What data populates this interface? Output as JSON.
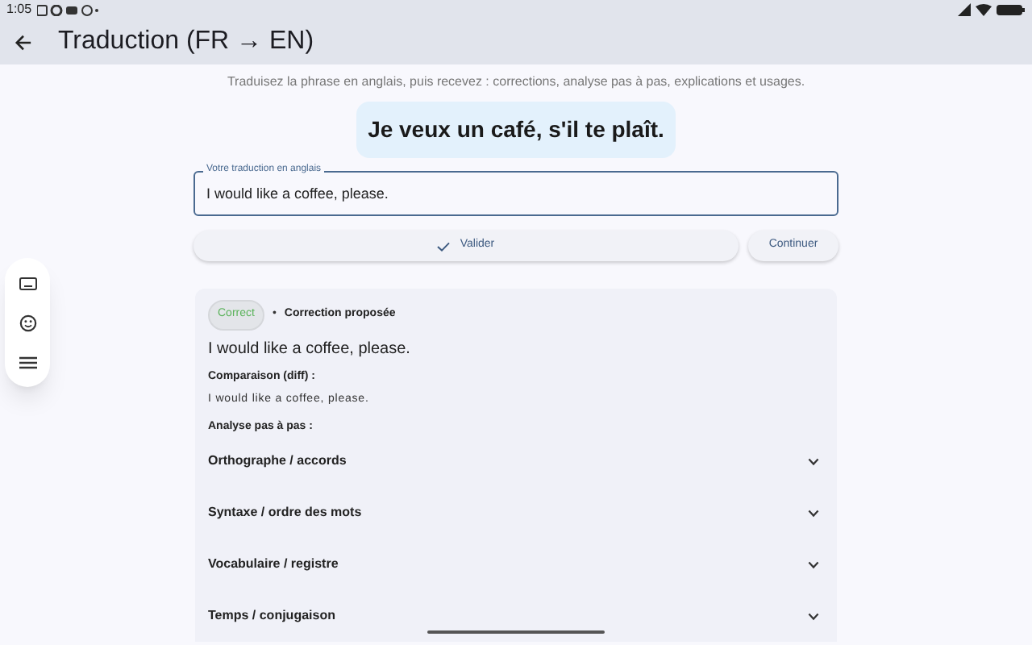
{
  "status_bar": {
    "time": "1:05"
  },
  "app_bar": {
    "title": "Traduction (FR → EN)"
  },
  "instructions": "Traduisez la phrase en anglais, puis recevez : corrections, analyse pas à pas, explications et usages.",
  "source_sentence": "Je veux un café, s'il te plaît.",
  "translation_field": {
    "label": "Votre traduction en anglais",
    "value": "I would like a coffee, please.",
    "focused": true
  },
  "buttons": [
    {
      "label": "Valider",
      "kind": "primary"
    },
    {
      "label": "Continuer",
      "kind": "secondary"
    }
  ],
  "result": {
    "badge": "Correct",
    "separator": "•",
    "heading": "Correction proposée",
    "corrected": "I would like a coffee, please.",
    "diff_label": "Comparaison (diff) :",
    "diff_text": "I would like a coffee, please.",
    "analysis_label": "Analyse pas à pas :",
    "sections": [
      {
        "title": "Orthographe / accords",
        "expanded": false
      },
      {
        "title": "Syntaxe / ordre des mots",
        "expanded": false
      },
      {
        "title": "Vocabulaire / registre",
        "expanded": false
      },
      {
        "title": "Temps / conjugaison",
        "expanded": false
      }
    ]
  }
}
